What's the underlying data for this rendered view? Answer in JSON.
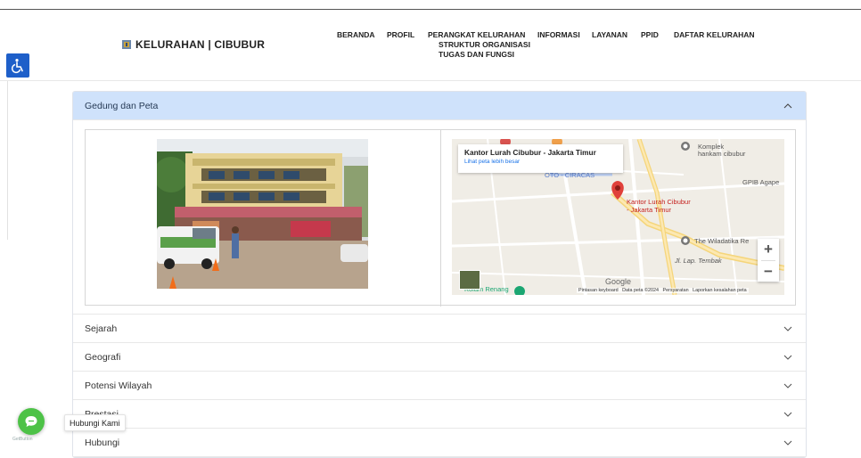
{
  "brand": {
    "name": "KELURAHAN | CIBUBUR"
  },
  "nav": {
    "beranda": "BERANDA",
    "profil": "PROFIL",
    "perangkat": "PERANGKAT KELURAHAN",
    "struktur": "STRUKTUR ORGANISASI",
    "tugas": "TUGAS DAN FUNGSI",
    "informasi": "INFORMASI",
    "layanan": "LAYANAN",
    "ppid": "PPID",
    "daftar": "DAFTAR KELURAHAN"
  },
  "accessibility": {
    "icon": "wheelchair-icon",
    "color": "#1e5fc9"
  },
  "accordion": {
    "active": {
      "label": "Gedung dan Peta",
      "color": "#cfe2fb"
    },
    "items": [
      {
        "label": "Sejarah"
      },
      {
        "label": "Geografi"
      },
      {
        "label": "Potensi Wilayah"
      },
      {
        "label": "Prestasi"
      },
      {
        "label": "Hubungi"
      }
    ]
  },
  "map": {
    "card_title": "Kantor Lurah Cibubur - Jakarta Timur",
    "card_link": "Lihat peta lebih besar",
    "pin_label_1": "Kantor Lurah Cibubur",
    "pin_label_2": "- Jakarta Timur",
    "labels": {
      "komplek": "Komplek",
      "hankam": "hankam cibubur",
      "gpib": "GPIB Agape",
      "wiladatika": "The Wiladatika Re",
      "jl_tembak": "Jl. Lap. Tembak",
      "oto": "OTO - CIRACAS",
      "kolam": "Kolam Renang",
      "google": "Google"
    },
    "footer": {
      "keyboard": "Pintasan keyboard",
      "data": "Data peta ©2024",
      "terms": "Persyaratan",
      "report": "Laporkan kesalahan peta"
    },
    "zoom_in": "+",
    "zoom_out": "−"
  },
  "contact": {
    "label": "Hubungi Kami",
    "color": "#4dc247",
    "powered": "GetButton"
  }
}
